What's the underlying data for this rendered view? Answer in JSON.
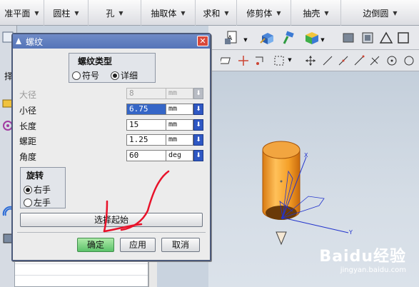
{
  "ribbon": {
    "items": [
      {
        "label": "准平面",
        "has_arrow": true
      },
      {
        "label": "圆柱",
        "has_arrow": true
      },
      {
        "label": "孔",
        "has_arrow": true
      },
      {
        "label": "抽取体",
        "has_arrow": true
      },
      {
        "label": "求和",
        "has_arrow": true
      },
      {
        "label": "修剪体",
        "has_arrow": true
      },
      {
        "label": "抽壳",
        "has_arrow": true
      },
      {
        "label": "边倒圆",
        "has_arrow": true
      }
    ]
  },
  "left_panel": {
    "fragment_label": "择"
  },
  "dialog": {
    "title": "螺纹",
    "close_glyph": "✕",
    "thread_type": {
      "title": "螺纹类型",
      "options": [
        {
          "label": "符号",
          "selected": false
        },
        {
          "label": "详细",
          "selected": true
        }
      ]
    },
    "fields": [
      {
        "label": "大径",
        "value": "8",
        "unit": "mm",
        "enabled": false
      },
      {
        "label": "小径",
        "value": "6.75",
        "unit": "mm",
        "enabled": true,
        "highlighted": true
      },
      {
        "label": "长度",
        "value": "15",
        "unit": "mm",
        "enabled": true
      },
      {
        "label": "螺距",
        "value": "1.25",
        "unit": "mm",
        "enabled": true
      },
      {
        "label": "角度",
        "value": "60",
        "unit": "deg",
        "enabled": true
      }
    ],
    "rotation": {
      "title": "旋转",
      "options": [
        {
          "label": "右手",
          "selected": true
        },
        {
          "label": "左手",
          "selected": false
        }
      ]
    },
    "select_start_button": "选择起始",
    "buttons": {
      "ok": "确定",
      "apply": "应用",
      "cancel": "取消"
    }
  },
  "viewport": {
    "axis_labels": {
      "x": "X",
      "y": "Y"
    }
  },
  "watermark": {
    "brand": "Baidu经验",
    "url": "jingyan.baidu.com"
  }
}
